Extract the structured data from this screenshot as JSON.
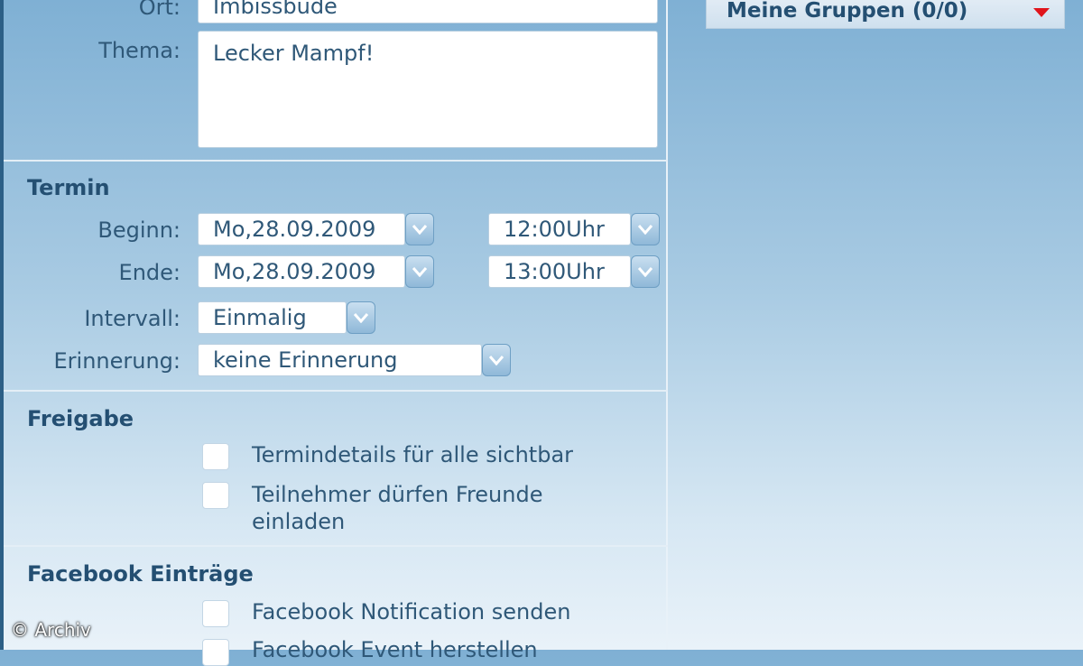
{
  "form": {
    "ort": {
      "label": "Ort:",
      "value": "Imbissbude"
    },
    "thema": {
      "label": "Thema:",
      "value": "Lecker Mampf!"
    }
  },
  "termin": {
    "title": "Termin",
    "beginn": {
      "label": "Beginn:",
      "date": "Mo,28.09.2009",
      "time": "12:00Uhr"
    },
    "ende": {
      "label": "Ende:",
      "date": "Mo,28.09.2009",
      "time": "13:00Uhr"
    },
    "intervall": {
      "label": "Intervall:",
      "value": "Einmalig"
    },
    "erinnerung": {
      "label": "Erinnerung:",
      "value": "keine Erinnerung"
    }
  },
  "freigabe": {
    "title": "Freigabe",
    "options": [
      {
        "label": "Termindetails für alle sichtbar",
        "checked": false
      },
      {
        "label": "Teilnehmer dürfen Freunde einladen",
        "checked": false
      }
    ]
  },
  "facebook": {
    "title": "Facebook Einträge",
    "options": [
      {
        "label": "Facebook Notification senden",
        "checked": false
      },
      {
        "label": "Facebook Event herstellen",
        "checked": false
      }
    ]
  },
  "sidebar": {
    "groups_label": "Meine Gruppen (0/0)",
    "expand_icon": "triangle-down-icon",
    "accent_color": "#e0141b"
  },
  "watermark": "© Archiv",
  "colors": {
    "text": "#2f5878",
    "heading": "#244f72",
    "background_top": "#7fb0d4",
    "background_bottom": "#e9f2f9"
  }
}
